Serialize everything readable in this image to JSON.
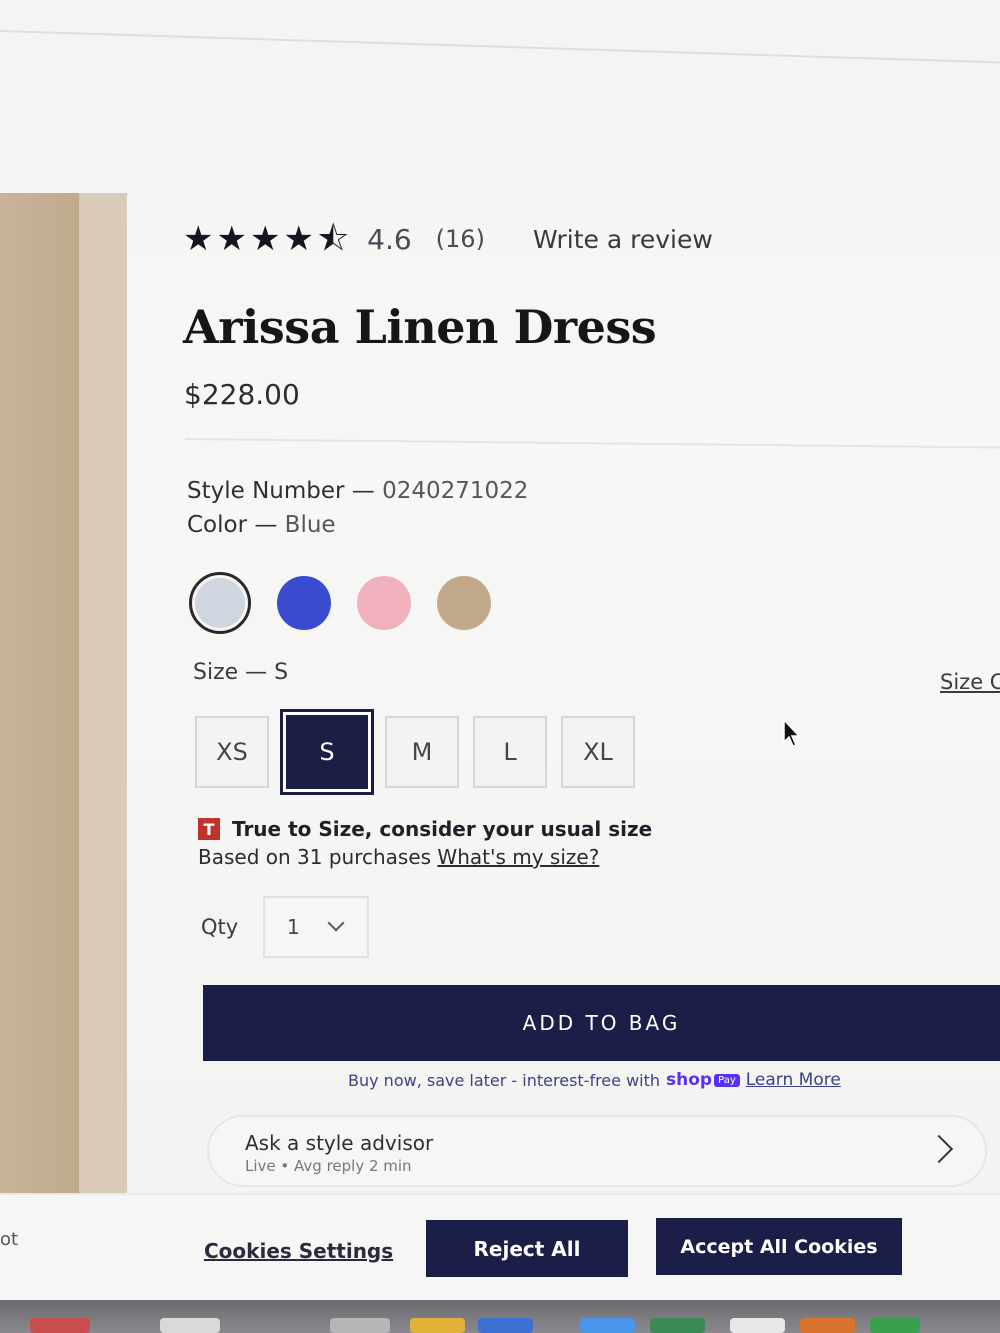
{
  "product": {
    "rating": {
      "stars": 4.6,
      "value": "4.6",
      "count": "(16)",
      "write_review_label": "Write a review"
    },
    "title": "Arissa Linen Dress",
    "price": "$228.00",
    "style_number_label": "Style Number — ",
    "style_number": "0240271022",
    "color_label": "Color — ",
    "color_value": "Blue",
    "swatches": [
      {
        "name": "light-blue",
        "color": "#cfd6df",
        "selected": true
      },
      {
        "name": "blue",
        "color": "#3a4bd0",
        "selected": false
      },
      {
        "name": "pink",
        "color": "#f0b1bd",
        "selected": false
      },
      {
        "name": "tan",
        "color": "#c2a88a",
        "selected": false
      }
    ],
    "size_label": "Size — S",
    "size_chart_label": "Size C",
    "sizes": [
      "XS",
      "S",
      "M",
      "L",
      "XL"
    ],
    "selected_size": "S",
    "fit": {
      "badge": "T",
      "headline": "True to Size, consider your usual size",
      "sub_prefix": "Based on 31 purchases ",
      "link": "What's my size?"
    },
    "qty_label": "Qty",
    "qty_value": "1",
    "add_to_bag_label": "ADD TO BAG",
    "shop_pay": {
      "text": "Buy now, save later - interest-free with",
      "logo": "shop",
      "badge": "Pay",
      "link": "Learn More"
    },
    "advisor": {
      "title": "Ask a style advisor",
      "subtitle": "Live • Avg reply 2 min"
    }
  },
  "cookies": {
    "left_fragment": "ot",
    "settings_label": "Cookies Settings",
    "reject_label": "Reject All",
    "accept_label": "Accept All Cookies"
  },
  "colors": {
    "navy": "#1b1f47",
    "badge_red": "#c0322c",
    "shop_purple": "#5a31f4"
  }
}
